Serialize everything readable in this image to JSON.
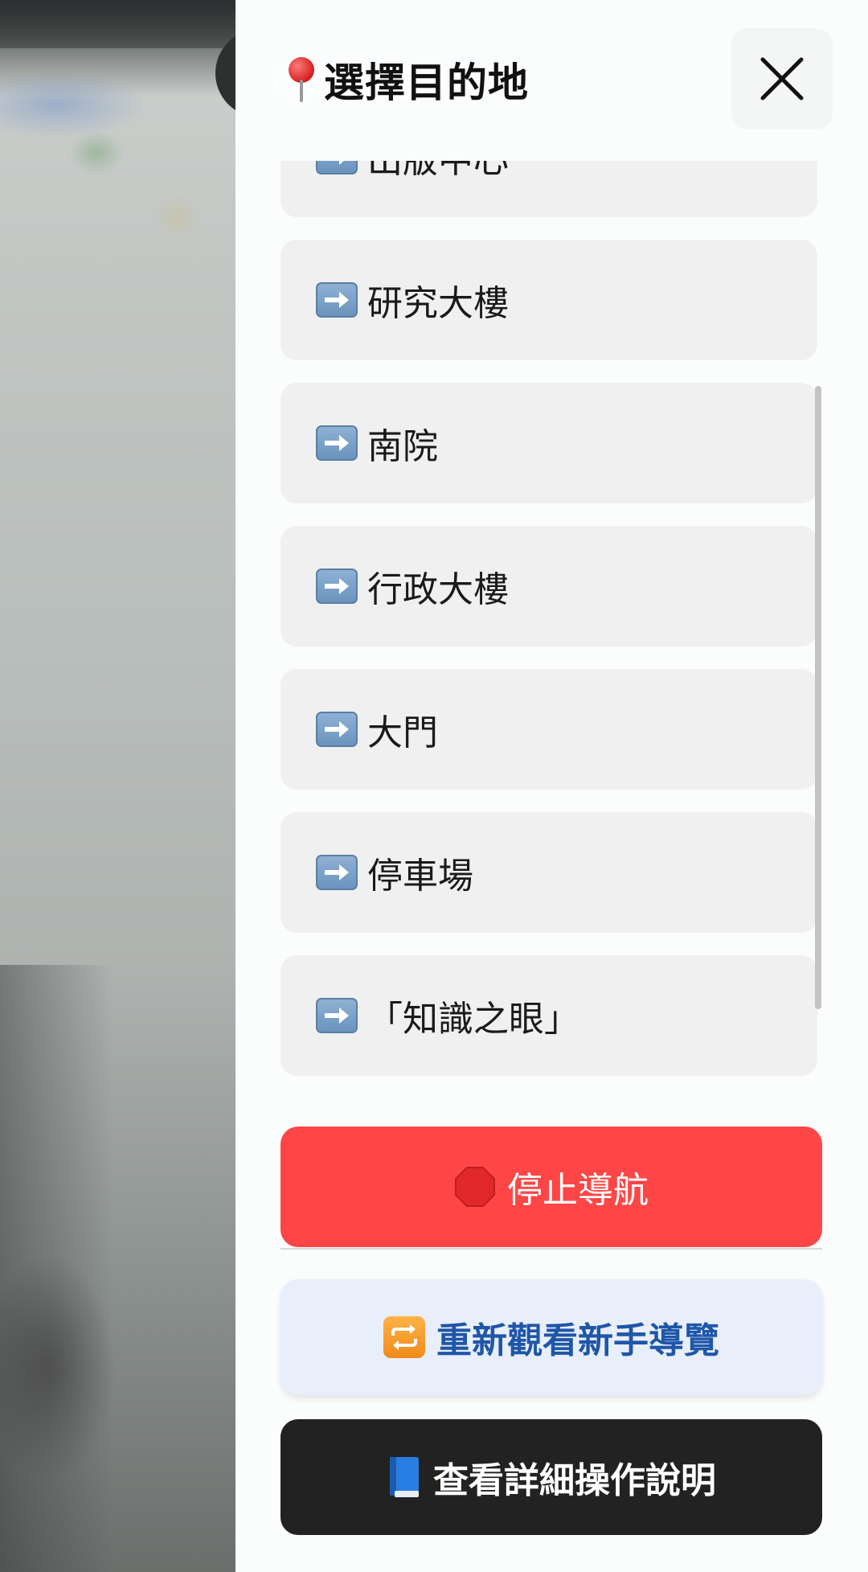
{
  "header": {
    "ghost_title": "選擇目的...",
    "title": "選擇目的地"
  },
  "destinations": [
    {
      "label": "出版中心"
    },
    {
      "label": "研究大樓"
    },
    {
      "label": "南院"
    },
    {
      "label": "行政大樓"
    },
    {
      "label": "大門"
    },
    {
      "label": "停車場"
    },
    {
      "label": "「知識之眼」"
    }
  ],
  "actions": {
    "stop_label": "停止導航",
    "tour_label": "重新觀看新手導覽",
    "guide_label": "查看詳細操作說明"
  },
  "colors": {
    "stop": "#ff4646",
    "tour_bg": "#e8effb",
    "tour_text": "#1f56a8",
    "guide_bg": "#222222",
    "list_item_bg": "#f0f0f0"
  },
  "icons": {
    "title": "round-pushpin-icon",
    "close": "close-icon",
    "item": "right-arrow-icon",
    "stop": "stop-sign-icon",
    "tour": "repeat-icon",
    "guide": "blue-book-icon"
  }
}
